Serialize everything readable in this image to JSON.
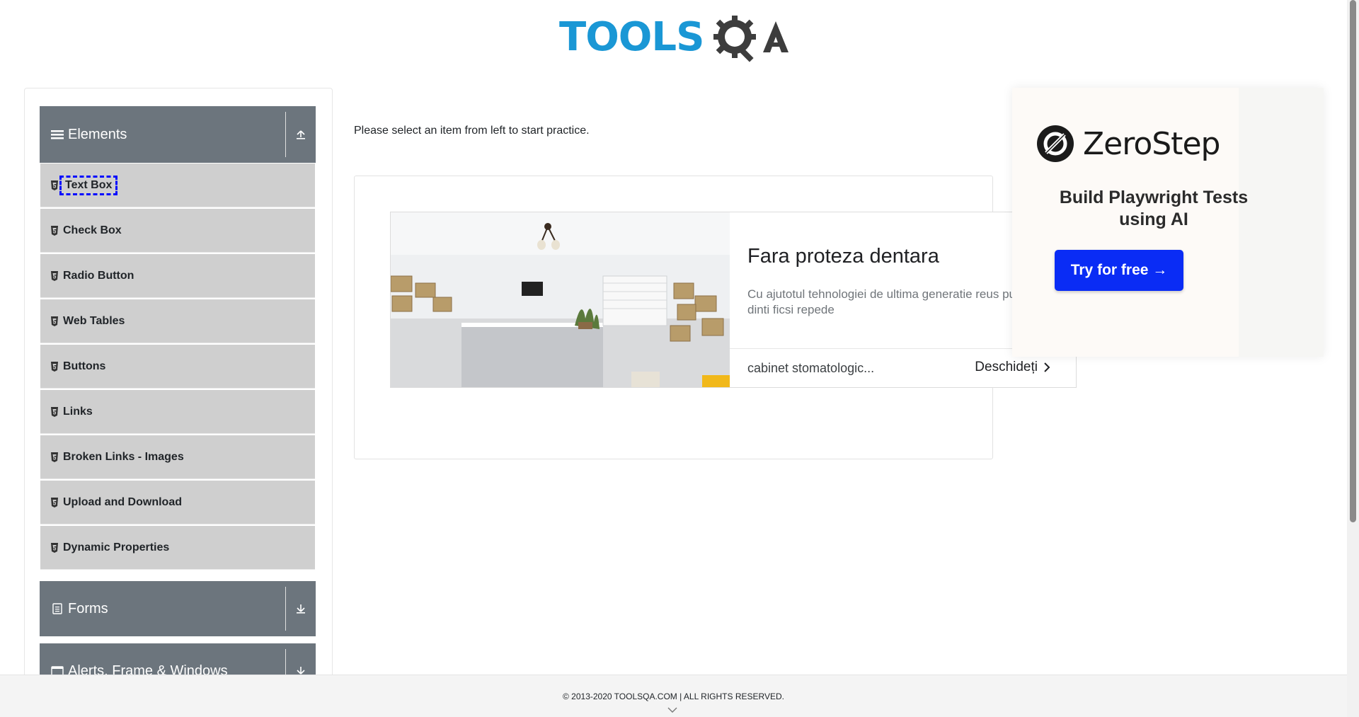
{
  "header": {
    "logo_primary": "TOOLS",
    "logo_secondary": "QA"
  },
  "sidebar": {
    "groups": [
      {
        "label": "Elements",
        "icon": "hamburger-icon",
        "state": "expanded"
      },
      {
        "label": "Forms",
        "icon": "form-icon",
        "state": "collapsed"
      },
      {
        "label": "Alerts, Frame & Windows",
        "icon": "window-icon",
        "state": "collapsed"
      }
    ],
    "items": [
      {
        "label": "Text Box",
        "active": true
      },
      {
        "label": "Check Box"
      },
      {
        "label": "Radio Button"
      },
      {
        "label": "Web Tables"
      },
      {
        "label": "Buttons"
      },
      {
        "label": "Links"
      },
      {
        "label": "Broken Links - Images"
      },
      {
        "label": "Upload and Download"
      },
      {
        "label": "Dynamic Properties"
      }
    ]
  },
  "main": {
    "prompt": "Please select an item from left to start practice."
  },
  "ad": {
    "title": "Fara proteza dentara",
    "description": "Cu ajutotul tehnologiei de ultima generatie reus punem dinti ficsi repede",
    "site": "cabinet stomatologic...",
    "cta": "Deschideți"
  },
  "side_ad": {
    "brand": "ZeroStep",
    "tagline": "Build Playwright Tests using AI",
    "button": "Try for free →",
    "brand_color": "#0a2cf5"
  },
  "footer": {
    "text": "© 2013-2020 TOOLSQA.COM | ALL RIGHTS RESERVED."
  }
}
